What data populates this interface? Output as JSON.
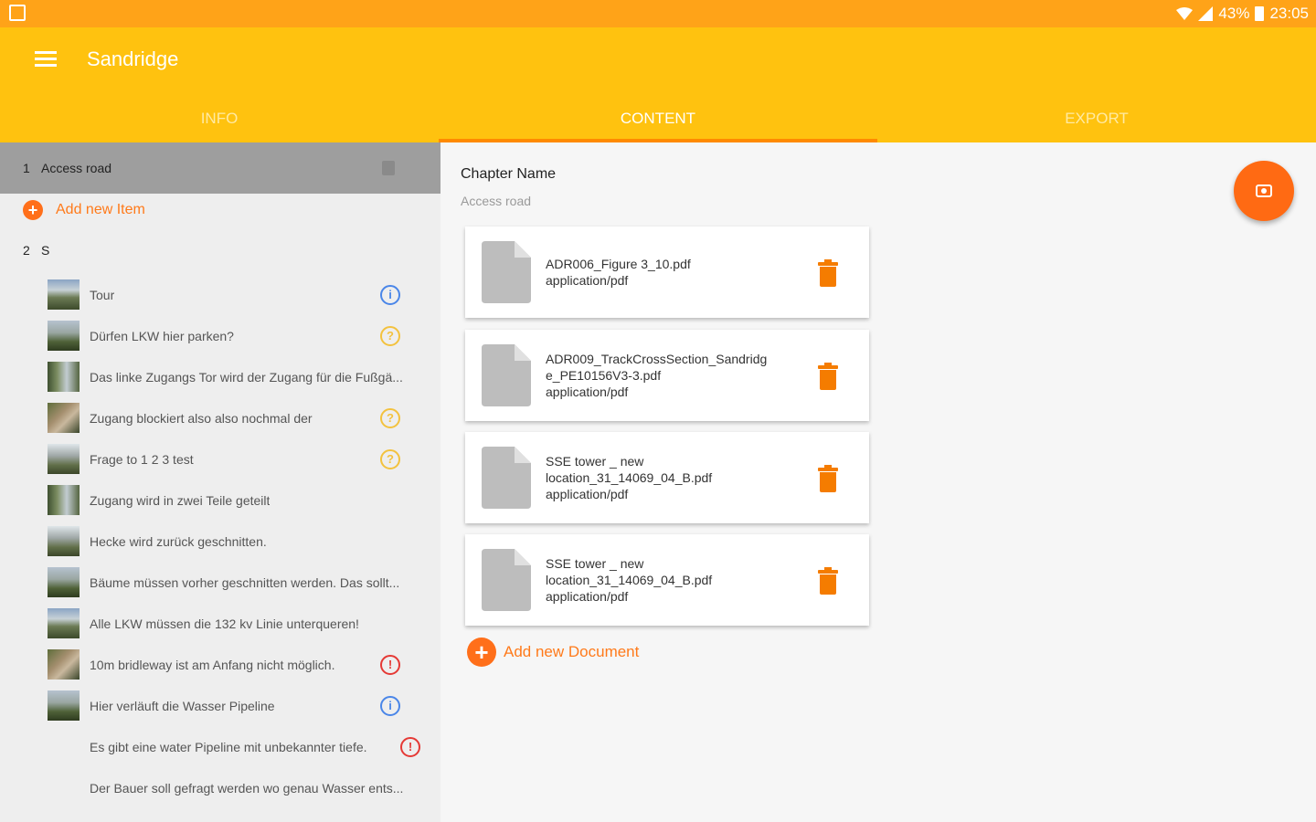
{
  "status_bar": {
    "battery": "43%",
    "time": "23:05"
  },
  "app_bar": {
    "title": "Sandridge"
  },
  "tabs": [
    {
      "label": "INFO"
    },
    {
      "label": "CONTENT"
    },
    {
      "label": "EXPORT"
    }
  ],
  "sidebar": {
    "chapter1": {
      "number": "1",
      "name": "Access road"
    },
    "add_item_label": "Add new Item",
    "chapter2": {
      "number": "2",
      "name": "S"
    },
    "items": [
      {
        "text": "Tour",
        "badge": "info"
      },
      {
        "text": "Dürfen LKW hier parken?",
        "badge": "question"
      },
      {
        "text": "Das linke Zugangs Tor wird der Zugang für die Fußgä...",
        "badge": ""
      },
      {
        "text": "Zugang blockiert also also nochmal der",
        "badge": "question"
      },
      {
        "text": "Frage to 1 2 3 test",
        "badge": "question"
      },
      {
        "text": "Zugang wird in zwei Teile geteilt",
        "badge": ""
      },
      {
        "text": "Hecke wird zurück geschnitten.",
        "badge": ""
      },
      {
        "text": "Bäume müssen vorher geschnitten werden. Das sollt...",
        "badge": ""
      },
      {
        "text": "Alle LKW müssen die 132 kv Linie unterqueren!",
        "badge": ""
      },
      {
        "text": "10m bridleway ist am Anfang nicht möglich.",
        "badge": "warning"
      },
      {
        "text": "Hier verläuft die Wasser Pipeline",
        "badge": "info"
      },
      {
        "text": "Es gibt eine water Pipeline mit unbekannter tiefe.",
        "badge": "warning"
      },
      {
        "text": "Der Bauer soll gefragt werden wo genau Wasser ents...",
        "badge": ""
      }
    ]
  },
  "content": {
    "chapter_label": "Chapter Name",
    "chapter_value": "Access road",
    "documents": [
      {
        "line1": "ADR006_Figure 3_10.pdf",
        "line2": "",
        "type": "application/pdf"
      },
      {
        "line1": "ADR009_TrackCrossSection_Sandridg",
        "line2": "e_PE10156V3-3.pdf",
        "type": "application/pdf"
      },
      {
        "line1": "SSE tower _ new",
        "line2": "location_31_14069_04_B.pdf",
        "type": "application/pdf"
      },
      {
        "line1": "SSE tower _ new",
        "line2": "location_31_14069_04_B.pdf",
        "type": "application/pdf"
      }
    ],
    "add_document_label": "Add new Document"
  },
  "colors": {
    "status_bar": "#ffa318",
    "app_bar": "#ffc20f",
    "accent": "#ff6a13"
  }
}
